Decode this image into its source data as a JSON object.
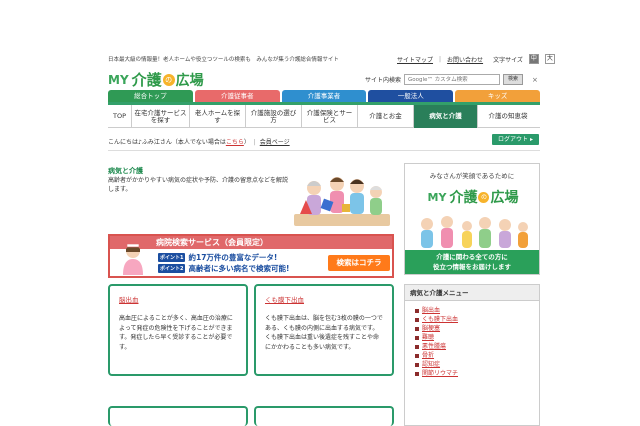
{
  "header": {
    "tagline": "日本最大級の情報量！老人ホームや役立つツールの検索も　みんなが集う介護総合情報サイト",
    "links": [
      "サイトマップ",
      "お問い合わせ"
    ],
    "font_size_label": "文字サイズ",
    "font_sizes": [
      "中",
      "大"
    ],
    "logo": {
      "my": "MY",
      "kaigo": "介護",
      "no": "の",
      "hiroba": "広場"
    },
    "search": {
      "label": "サイト内検索",
      "placeholder": "Google™ カスタム検索",
      "button": "検索",
      "close": "×"
    }
  },
  "category_tabs": [
    {
      "label": "総合トップ",
      "color": "#2f9a55"
    },
    {
      "label": "介護従事者",
      "color": "#e86a6a"
    },
    {
      "label": "介護事業者",
      "color": "#2f8fcf"
    },
    {
      "label": "一般法人",
      "color": "#1f4fa0"
    },
    {
      "label": "キッズ",
      "color": "#f2a03a"
    }
  ],
  "nav": [
    {
      "label": "TOP",
      "width": 24
    },
    {
      "label": "在宅介護サービスを探す",
      "width": 58
    },
    {
      "label": "老人ホームを探す",
      "width": 56
    },
    {
      "label": "介護施設の選び方",
      "width": 56
    },
    {
      "label": "介護保険とサービス",
      "width": 56
    },
    {
      "label": "介護とお金",
      "width": 56
    },
    {
      "label": "病気と介護",
      "width": 64,
      "active": true
    },
    {
      "label": "介護の知恵袋",
      "width": 60
    }
  ],
  "greeting": {
    "prefix": "こんにちは♪ふみ江さん（本人でない場合は",
    "here": "こちら",
    "suffix": "）",
    "member_page": "会員ページ"
  },
  "logout": "ログアウト ▸",
  "intro": {
    "title": "病気と介護",
    "description": "高齢者がかかりやすい病気の症状や予防、介護の留意点などを解説します。"
  },
  "banner": {
    "title": "病院検索サービス（会員限定）",
    "points": [
      {
        "tag": "ポイント1",
        "text": "約17万件の豊富なデータ!"
      },
      {
        "tag": "ポイント2",
        "text": "高齢者に多い病名で検索可能!"
      }
    ],
    "cta": "検索はコチラ"
  },
  "cards": [
    {
      "title": "脳出血",
      "body": "高血圧によることが多く、高血圧の治療によって発症の危険性を下げることができます。発症したら早く受診することが必要です。"
    },
    {
      "title": "くも膜下出血",
      "body": "くも膜下出血は、脳を包む3枚の膜の一つである、くも膜の内側に出血する病気です。くも膜下出血は重い後遺症を残すことや命にかかわることも多い病気です。"
    }
  ],
  "promo": {
    "title": "みなさんが笑顔であるために",
    "footer_line1": "介護に関わる全ての方に",
    "footer_line2": "役立つ情報をお届けします"
  },
  "menu": {
    "title": "病気と介護メニュー",
    "items": [
      "脳出血",
      "くも膜下出血",
      "脳梗塞",
      "難聴",
      "悪性腫瘍",
      "骨折",
      "認知症",
      "関節リウマチ"
    ]
  }
}
